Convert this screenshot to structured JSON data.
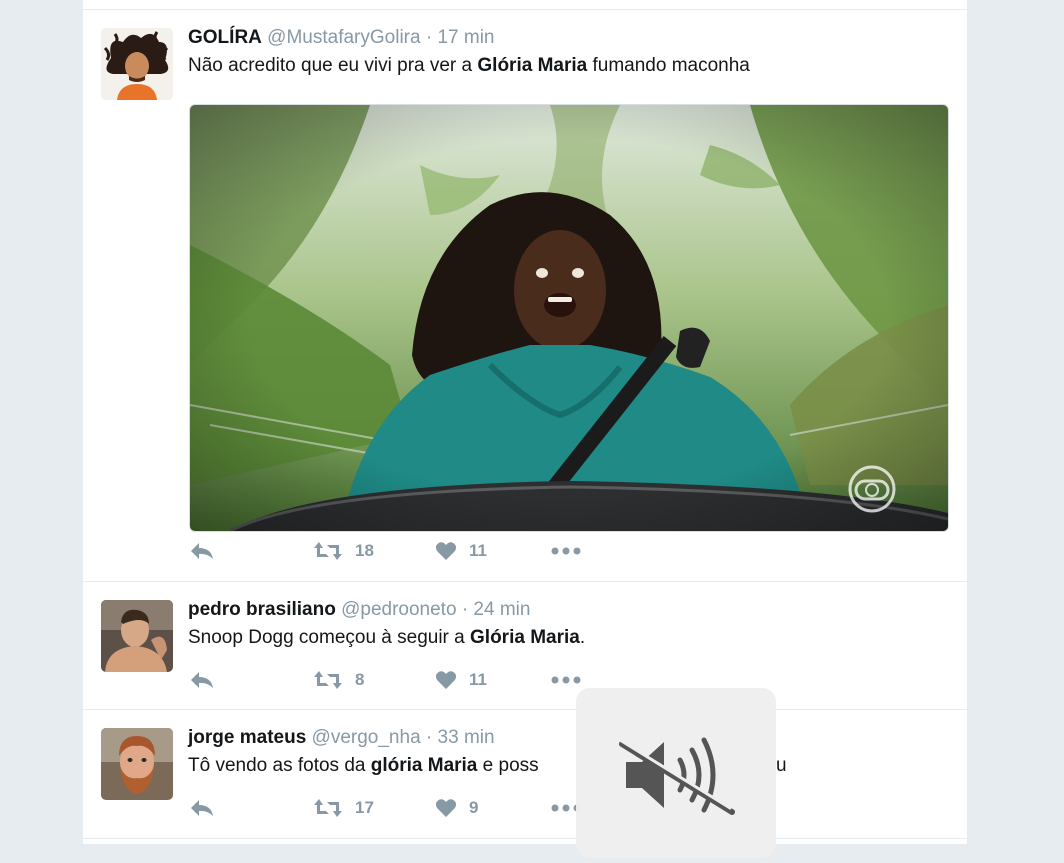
{
  "colors": {
    "accent": "#8899a6",
    "text": "#14171a",
    "background": "#e6ecf0"
  },
  "tweets": [
    {
      "fullname": "GOLÍRA",
      "handle": "@MustafaryGolira",
      "separator": "·",
      "time": "17 min",
      "text_parts": [
        "Não acredito que eu vivi pra ver a ",
        "Glória Maria",
        " fumando maconha"
      ],
      "has_media": true,
      "media_logo": "globo-logo-watermark",
      "retweets": "18",
      "likes": "11"
    },
    {
      "fullname": "pedro brasiliano",
      "handle": "@pedrooneto",
      "separator": "·",
      "time": "24 min",
      "text_parts": [
        "Snoop Dogg começou à seguir a ",
        "Glória Maria",
        "."
      ],
      "retweets": "8",
      "likes": "11"
    },
    {
      "fullname": "jorge mateus",
      "handle": "@vergo_nha",
      "separator": "·",
      "time": "33 min",
      "text_parts": [
        "Tô vendo as fotos da ",
        "glória Maria",
        " e poss"
      ],
      "text_tail": "u",
      "retweets": "17",
      "likes": "9"
    }
  ],
  "icons": {
    "reply": "reply-icon",
    "retweet": "retweet-icon",
    "like": "heart-icon",
    "more": "more-dots-icon",
    "mute": "speaker-muted-icon"
  }
}
